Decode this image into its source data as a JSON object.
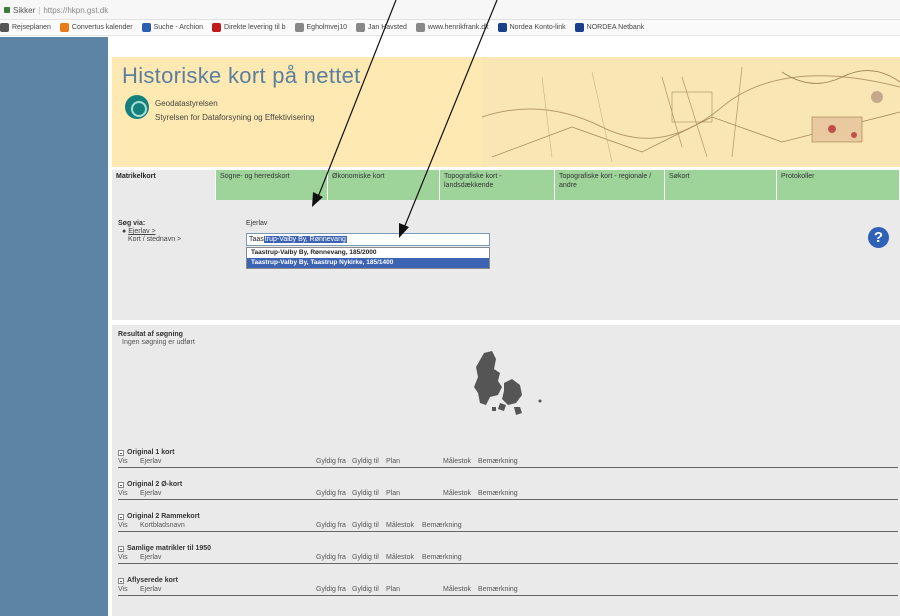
{
  "browser": {
    "secure_label": "Sikker",
    "url": "https://hkpn.gst.dk",
    "bookmarks": [
      "Rejseplanen",
      "Convertus kalender",
      "Suche - Archion",
      "Direkte levering til b",
      "Egholmvej10",
      "Jan Havsted",
      "www.henrikfrank.dk",
      "Nordea Konto-link",
      "NORDEA Netbank"
    ],
    "bookmark_colors": [
      "#555555",
      "#e87a1a",
      "#2b5fb0",
      "#c21a1a",
      "#888888",
      "#888888",
      "#888888",
      "#1b3f8a",
      "#1b3f8a"
    ]
  },
  "header": {
    "title": "Historiske kort på nettet",
    "agency_line1": "Geodatastyrelsen",
    "agency_line2": "Styrelsen for Dataforsyning og Effektivisering"
  },
  "tabs": [
    "Matrikelkort",
    "Sogne- og herredskort",
    "Økonomiske kort",
    "Topografiske kort - landsdækkende",
    "Topografiske kort - regionale / andre",
    "Søkort",
    "Protokoller"
  ],
  "search": {
    "search_by_label": "Søg via:",
    "option_owner": "Ejerlav >",
    "option_sheet": "Kort / stednavn >",
    "owner_label": "Ejerlav",
    "typed_text": "Taas",
    "selected_suggestion": "trup-Valby By, Rønnevang",
    "suggestions": [
      "Taastrup-Valby By, Rønnevang, 185/2000",
      "Taastrup-Valby By, Taastrup Nykirke, 185/1400"
    ],
    "help_icon_label": "?"
  },
  "results": {
    "title": "Resultat af søgning",
    "subtitle": "Ingen søgning er udført",
    "sections": [
      {
        "title": "Original 1 kort",
        "columns": [
          "Vis",
          "Ejerlav",
          "Gyldig fra",
          "Gyldig til",
          "Plan",
          "Målestok",
          "Bemærkning"
        ]
      },
      {
        "title": "Original 2 Ø-kort",
        "columns": [
          "Vis",
          "Ejerlav",
          "Gyldig fra",
          "Gyldig til",
          "Plan",
          "Målestok",
          "Bemærkning"
        ]
      },
      {
        "title": "Original 2 Rammekort",
        "columns": [
          "Vis",
          "Kortbladsnavn",
          "Gyldig fra",
          "Gyldig til",
          "Målestok",
          "Bemærkning"
        ]
      },
      {
        "title": "Samlige matrikler til 1950",
        "columns": [
          "Vis",
          "Ejerlav",
          "Gyldig fra",
          "Gyldig til",
          "Målestok",
          "Bemærkning"
        ]
      },
      {
        "title": "Aflyserede kort",
        "columns": [
          "Vis",
          "Ejerlav",
          "Gyldig fra",
          "Gyldig til",
          "Plan",
          "Målestok",
          "Bemærkning"
        ]
      }
    ]
  }
}
